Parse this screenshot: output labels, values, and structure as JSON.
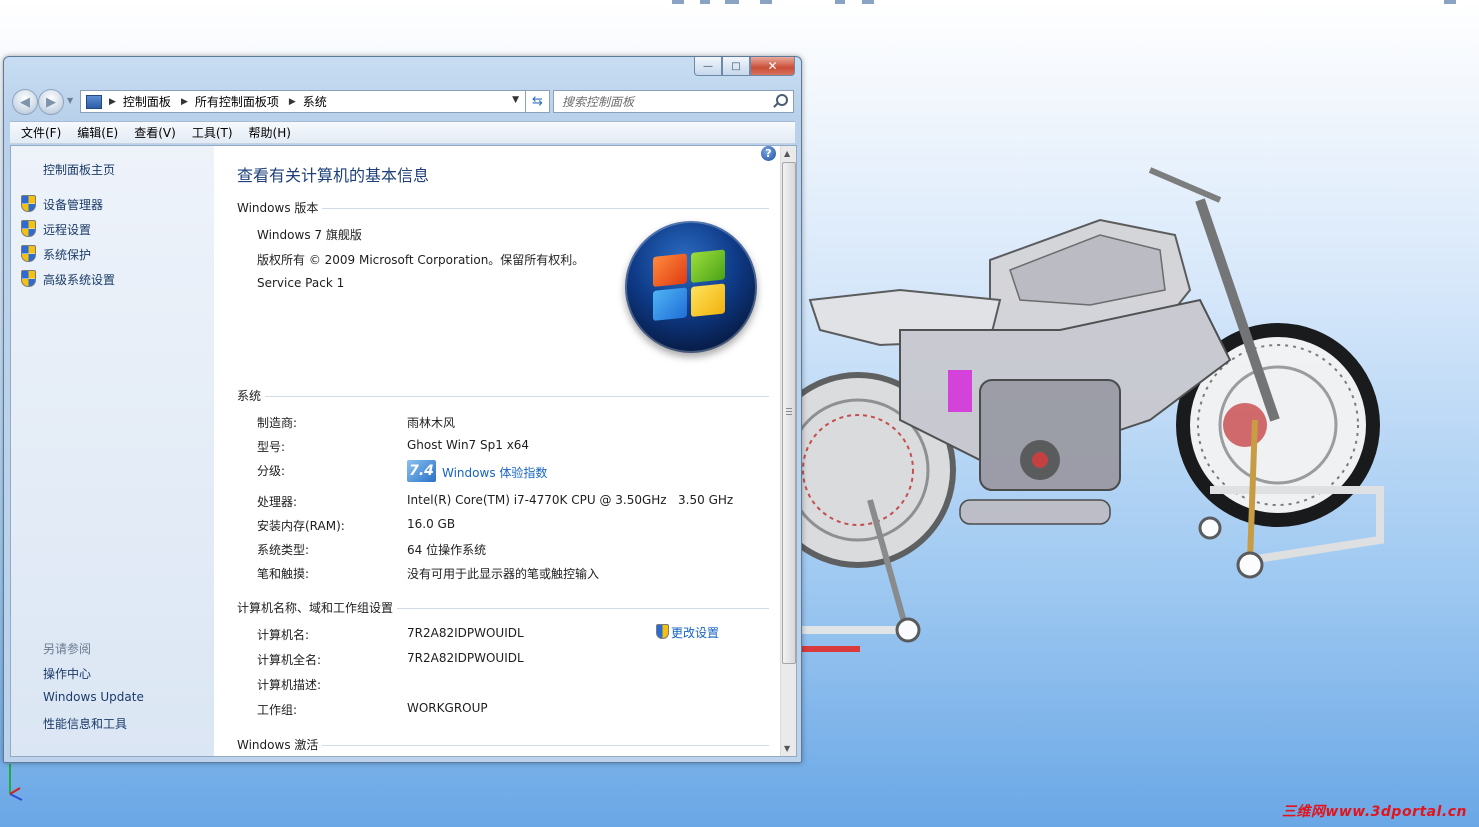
{
  "window": {
    "caption": {
      "minimize": "—",
      "maximize": "□",
      "close": "✕"
    },
    "nav": {
      "back": "◀",
      "forward": "▶",
      "dropdown": "▼"
    },
    "address": {
      "crumbs": [
        "控制面板",
        "所有控制面板项",
        "系统"
      ]
    },
    "search": {
      "placeholder": "搜索控制面板"
    },
    "menu": [
      "文件(F)",
      "编辑(E)",
      "查看(V)",
      "工具(T)",
      "帮助(H)"
    ]
  },
  "sidebar": {
    "home": "控制面板主页",
    "tasks": [
      "设备管理器",
      "远程设置",
      "系统保护",
      "高级系统设置"
    ],
    "see_also_label": "另请参阅",
    "see_also": [
      "操作中心",
      "Windows Update",
      "性能信息和工具"
    ]
  },
  "main": {
    "help": "?",
    "title": "查看有关计算机的基本信息",
    "windows_edition": {
      "header": "Windows 版本",
      "edition": "Windows 7 旗舰版",
      "copyright": "版权所有 © 2009 Microsoft Corporation。保留所有权利。",
      "service_pack": "Service Pack 1"
    },
    "system": {
      "header": "系统",
      "manufacturer_label": "制造商:",
      "manufacturer": "雨林木风",
      "model_label": "型号:",
      "model": "Ghost Win7 Sp1 x64",
      "rating_label": "分级:",
      "rating_score": "7.4",
      "rating_link": "Windows 体验指数",
      "processor_label": "处理器:",
      "processor": "Intel(R) Core(TM) i7-4770K CPU @ 3.50GHz   3.50 GHz",
      "ram_label": "安装内存(RAM):",
      "ram": "16.0 GB",
      "type_label": "系统类型:",
      "type": "64 位操作系统",
      "pen_label": "笔和触摸:",
      "pen": "没有可用于此显示器的笔或触控输入"
    },
    "computer": {
      "header": "计算机名称、域和工作组设置",
      "change_settings": "更改设置",
      "name_label": "计算机名:",
      "name": "7R2A82IDPWOUIDL",
      "fullname_label": "计算机全名:",
      "fullname": "7R2A82IDPWOUIDL",
      "desc_label": "计算机描述:",
      "workgroup_label": "工作组:",
      "workgroup": "WORKGROUP"
    },
    "activation": {
      "header": "Windows 激活"
    }
  },
  "watermark": "三维网www.3dportal.cn",
  "colors": {
    "link": "#1463c6",
    "title": "#1e3f7a",
    "close_button": "#c94d36"
  }
}
